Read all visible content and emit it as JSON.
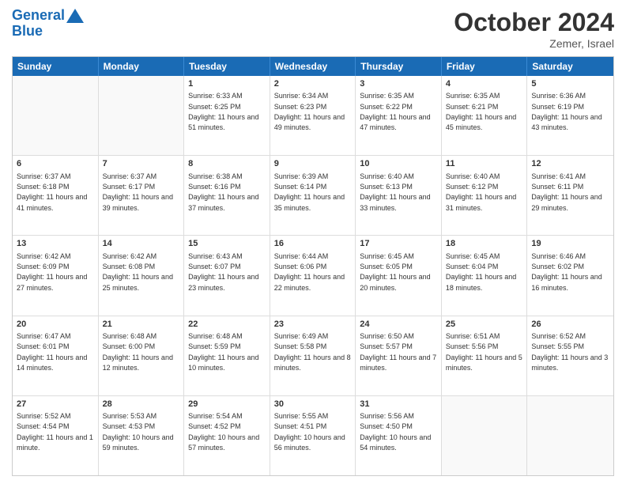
{
  "header": {
    "logo_line1": "General",
    "logo_line2": "Blue",
    "month": "October 2024",
    "location": "Zemer, Israel"
  },
  "days_of_week": [
    "Sunday",
    "Monday",
    "Tuesday",
    "Wednesday",
    "Thursday",
    "Friday",
    "Saturday"
  ],
  "weeks": [
    [
      {
        "day": "",
        "sunrise": "",
        "sunset": "",
        "daylight": ""
      },
      {
        "day": "",
        "sunrise": "",
        "sunset": "",
        "daylight": ""
      },
      {
        "day": "1",
        "sunrise": "Sunrise: 6:33 AM",
        "sunset": "Sunset: 6:25 PM",
        "daylight": "Daylight: 11 hours and 51 minutes."
      },
      {
        "day": "2",
        "sunrise": "Sunrise: 6:34 AM",
        "sunset": "Sunset: 6:23 PM",
        "daylight": "Daylight: 11 hours and 49 minutes."
      },
      {
        "day": "3",
        "sunrise": "Sunrise: 6:35 AM",
        "sunset": "Sunset: 6:22 PM",
        "daylight": "Daylight: 11 hours and 47 minutes."
      },
      {
        "day": "4",
        "sunrise": "Sunrise: 6:35 AM",
        "sunset": "Sunset: 6:21 PM",
        "daylight": "Daylight: 11 hours and 45 minutes."
      },
      {
        "day": "5",
        "sunrise": "Sunrise: 6:36 AM",
        "sunset": "Sunset: 6:19 PM",
        "daylight": "Daylight: 11 hours and 43 minutes."
      }
    ],
    [
      {
        "day": "6",
        "sunrise": "Sunrise: 6:37 AM",
        "sunset": "Sunset: 6:18 PM",
        "daylight": "Daylight: 11 hours and 41 minutes."
      },
      {
        "day": "7",
        "sunrise": "Sunrise: 6:37 AM",
        "sunset": "Sunset: 6:17 PM",
        "daylight": "Daylight: 11 hours and 39 minutes."
      },
      {
        "day": "8",
        "sunrise": "Sunrise: 6:38 AM",
        "sunset": "Sunset: 6:16 PM",
        "daylight": "Daylight: 11 hours and 37 minutes."
      },
      {
        "day": "9",
        "sunrise": "Sunrise: 6:39 AM",
        "sunset": "Sunset: 6:14 PM",
        "daylight": "Daylight: 11 hours and 35 minutes."
      },
      {
        "day": "10",
        "sunrise": "Sunrise: 6:40 AM",
        "sunset": "Sunset: 6:13 PM",
        "daylight": "Daylight: 11 hours and 33 minutes."
      },
      {
        "day": "11",
        "sunrise": "Sunrise: 6:40 AM",
        "sunset": "Sunset: 6:12 PM",
        "daylight": "Daylight: 11 hours and 31 minutes."
      },
      {
        "day": "12",
        "sunrise": "Sunrise: 6:41 AM",
        "sunset": "Sunset: 6:11 PM",
        "daylight": "Daylight: 11 hours and 29 minutes."
      }
    ],
    [
      {
        "day": "13",
        "sunrise": "Sunrise: 6:42 AM",
        "sunset": "Sunset: 6:09 PM",
        "daylight": "Daylight: 11 hours and 27 minutes."
      },
      {
        "day": "14",
        "sunrise": "Sunrise: 6:42 AM",
        "sunset": "Sunset: 6:08 PM",
        "daylight": "Daylight: 11 hours and 25 minutes."
      },
      {
        "day": "15",
        "sunrise": "Sunrise: 6:43 AM",
        "sunset": "Sunset: 6:07 PM",
        "daylight": "Daylight: 11 hours and 23 minutes."
      },
      {
        "day": "16",
        "sunrise": "Sunrise: 6:44 AM",
        "sunset": "Sunset: 6:06 PM",
        "daylight": "Daylight: 11 hours and 22 minutes."
      },
      {
        "day": "17",
        "sunrise": "Sunrise: 6:45 AM",
        "sunset": "Sunset: 6:05 PM",
        "daylight": "Daylight: 11 hours and 20 minutes."
      },
      {
        "day": "18",
        "sunrise": "Sunrise: 6:45 AM",
        "sunset": "Sunset: 6:04 PM",
        "daylight": "Daylight: 11 hours and 18 minutes."
      },
      {
        "day": "19",
        "sunrise": "Sunrise: 6:46 AM",
        "sunset": "Sunset: 6:02 PM",
        "daylight": "Daylight: 11 hours and 16 minutes."
      }
    ],
    [
      {
        "day": "20",
        "sunrise": "Sunrise: 6:47 AM",
        "sunset": "Sunset: 6:01 PM",
        "daylight": "Daylight: 11 hours and 14 minutes."
      },
      {
        "day": "21",
        "sunrise": "Sunrise: 6:48 AM",
        "sunset": "Sunset: 6:00 PM",
        "daylight": "Daylight: 11 hours and 12 minutes."
      },
      {
        "day": "22",
        "sunrise": "Sunrise: 6:48 AM",
        "sunset": "Sunset: 5:59 PM",
        "daylight": "Daylight: 11 hours and 10 minutes."
      },
      {
        "day": "23",
        "sunrise": "Sunrise: 6:49 AM",
        "sunset": "Sunset: 5:58 PM",
        "daylight": "Daylight: 11 hours and 8 minutes."
      },
      {
        "day": "24",
        "sunrise": "Sunrise: 6:50 AM",
        "sunset": "Sunset: 5:57 PM",
        "daylight": "Daylight: 11 hours and 7 minutes."
      },
      {
        "day": "25",
        "sunrise": "Sunrise: 6:51 AM",
        "sunset": "Sunset: 5:56 PM",
        "daylight": "Daylight: 11 hours and 5 minutes."
      },
      {
        "day": "26",
        "sunrise": "Sunrise: 6:52 AM",
        "sunset": "Sunset: 5:55 PM",
        "daylight": "Daylight: 11 hours and 3 minutes."
      }
    ],
    [
      {
        "day": "27",
        "sunrise": "Sunrise: 5:52 AM",
        "sunset": "Sunset: 4:54 PM",
        "daylight": "Daylight: 11 hours and 1 minute."
      },
      {
        "day": "28",
        "sunrise": "Sunrise: 5:53 AM",
        "sunset": "Sunset: 4:53 PM",
        "daylight": "Daylight: 10 hours and 59 minutes."
      },
      {
        "day": "29",
        "sunrise": "Sunrise: 5:54 AM",
        "sunset": "Sunset: 4:52 PM",
        "daylight": "Daylight: 10 hours and 57 minutes."
      },
      {
        "day": "30",
        "sunrise": "Sunrise: 5:55 AM",
        "sunset": "Sunset: 4:51 PM",
        "daylight": "Daylight: 10 hours and 56 minutes."
      },
      {
        "day": "31",
        "sunrise": "Sunrise: 5:56 AM",
        "sunset": "Sunset: 4:50 PM",
        "daylight": "Daylight: 10 hours and 54 minutes."
      },
      {
        "day": "",
        "sunrise": "",
        "sunset": "",
        "daylight": ""
      },
      {
        "day": "",
        "sunrise": "",
        "sunset": "",
        "daylight": ""
      }
    ]
  ]
}
